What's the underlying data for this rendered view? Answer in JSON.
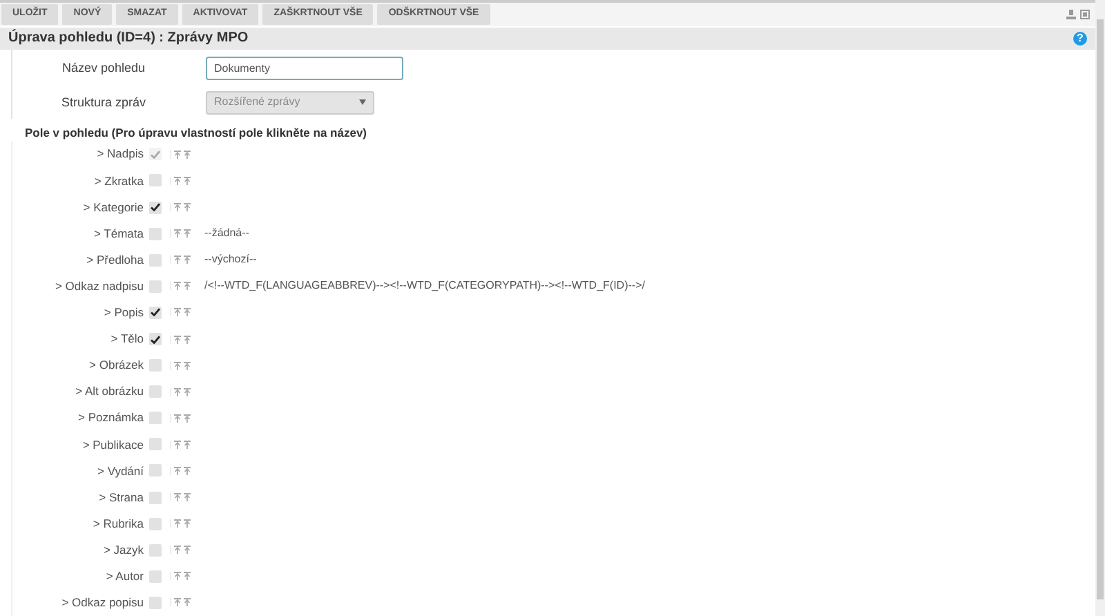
{
  "toolbar": {
    "buttons": [
      "ULOŽIT",
      "NOVÝ",
      "SMAZAT",
      "AKTIVOVAT",
      "ZAŠKRTNOUT VŠE",
      "ODŠKRTNOUT VŠE"
    ]
  },
  "title": "Úprava pohledu (ID=4) : Zprávy MPO",
  "help": "?",
  "form": {
    "name_label": "Název pohledu",
    "name_value": "Dokumenty",
    "structure_label": "Struktura zpráv",
    "structure_value": "Rozšířené zprávy",
    "structure_disabled": true
  },
  "fields_heading": "Pole v pohledu (Pro úpravu vlastností pole klikněte na název)",
  "fields": [
    {
      "label": "> Nadpis",
      "checked": true,
      "disabled": true
    },
    {
      "label": "> Zkratka",
      "checked": false,
      "disabled": false
    },
    {
      "label": "> Kategorie",
      "checked": true,
      "disabled": false
    },
    {
      "label": "> Témata",
      "checked": false,
      "disabled": false,
      "value": "--žádná--"
    },
    {
      "label": "> Předloha",
      "checked": false,
      "disabled": false,
      "value": "--výchozí--"
    },
    {
      "label": "> Odkaz nadpisu",
      "checked": false,
      "disabled": false,
      "value": "/<!--WTD_F(LANGUAGEABBREV)--><!--WTD_F(CATEGORYPATH)--><!--WTD_F(ID)-->/"
    },
    {
      "label": "> Popis",
      "checked": true,
      "disabled": false
    },
    {
      "label": "> Tělo",
      "checked": true,
      "disabled": false
    },
    {
      "label": "> Obrázek",
      "checked": false,
      "disabled": false
    },
    {
      "label": "> Alt obrázku",
      "checked": false,
      "disabled": false
    },
    {
      "label": "> Poznámka",
      "checked": false,
      "disabled": false
    },
    {
      "label": "> Publikace",
      "checked": false,
      "disabled": false
    },
    {
      "label": "> Vydání",
      "checked": false,
      "disabled": false
    },
    {
      "label": "> Strana",
      "checked": false,
      "disabled": false
    },
    {
      "label": "> Rubrika",
      "checked": false,
      "disabled": false
    },
    {
      "label": "> Jazyk",
      "checked": false,
      "disabled": false
    },
    {
      "label": "> Autor",
      "checked": false,
      "disabled": false
    },
    {
      "label": "> Odkaz popisu",
      "checked": false,
      "disabled": false
    }
  ]
}
